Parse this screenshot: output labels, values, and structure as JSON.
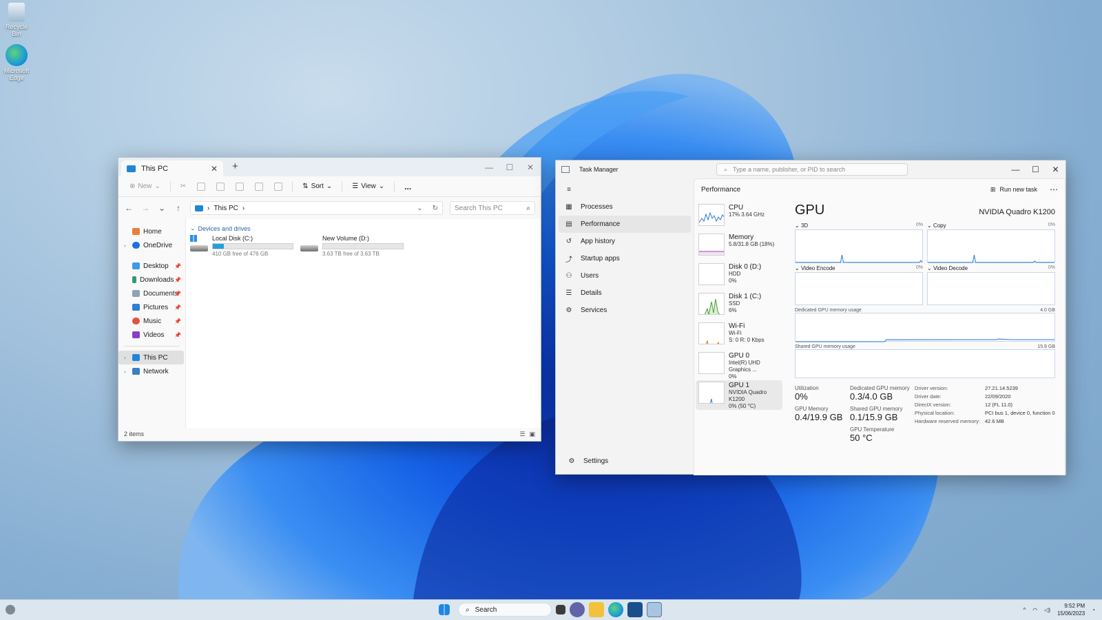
{
  "desktop": {
    "icons": [
      {
        "label": "Recycle Bin",
        "icon": "recycle-bin-icon"
      },
      {
        "label": "Microsoft Edge",
        "icon": "edge-icon"
      }
    ]
  },
  "explorer": {
    "tab_title": "This PC",
    "toolbar": {
      "new": "New",
      "sort": "Sort",
      "view": "View",
      "more": "..."
    },
    "breadcrumb": "This PC",
    "search_placeholder": "Search This PC",
    "nav": {
      "home": "Home",
      "onedrive": "OneDrive",
      "desktop": "Desktop",
      "downloads": "Downloads",
      "documents": "Documents",
      "pictures": "Pictures",
      "music": "Music",
      "videos": "Videos",
      "this_pc": "This PC",
      "network": "Network"
    },
    "group_label": "Devices and drives",
    "drives": [
      {
        "name": "Local Disk (C:)",
        "free": "410 GB free of 476 GB",
        "used_fraction": 0.14
      },
      {
        "name": "New Volume (D:)",
        "free": "3.63 TB free of 3.63 TB",
        "used_fraction": 0.0
      }
    ],
    "status": "2 items"
  },
  "taskmgr": {
    "title": "Task Manager",
    "search_placeholder": "Type a name, publisher, or PID to search",
    "nav": {
      "processes": "Processes",
      "performance": "Performance",
      "app_history": "App history",
      "startup_apps": "Startup apps",
      "users": "Users",
      "details": "Details",
      "services": "Services",
      "settings": "Settings"
    },
    "header_title": "Performance",
    "run_new_task": "Run new task",
    "resources": [
      {
        "name": "CPU",
        "line1": "17% 3.64 GHz",
        "line2": ""
      },
      {
        "name": "Memory",
        "line1": "5.8/31.8 GB (18%)",
        "line2": ""
      },
      {
        "name": "Disk 0 (D:)",
        "line1": "HDD",
        "line2": "0%"
      },
      {
        "name": "Disk 1 (C:)",
        "line1": "SSD",
        "line2": "6%"
      },
      {
        "name": "Wi-Fi",
        "line1": "Wi-Fi",
        "line2": "S: 0 R: 0 Kbps"
      },
      {
        "name": "GPU 0",
        "line1": "Intel(R) UHD Graphics ...",
        "line2": "0%"
      },
      {
        "name": "GPU 1",
        "line1": "NVIDIA Quadro K1200",
        "line2": "0% (50 °C)"
      }
    ],
    "gpu": {
      "title": "GPU",
      "model": "NVIDIA Quadro K1200",
      "engines": [
        {
          "name": "3D",
          "pct": "0%"
        },
        {
          "name": "Copy",
          "pct": "0%"
        },
        {
          "name": "Video Encode",
          "pct": "0%"
        },
        {
          "name": "Video Decode",
          "pct": "0%"
        }
      ],
      "dedicated_label": "Dedicated GPU memory usage",
      "dedicated_max": "4.0 GB",
      "shared_label": "Shared GPU memory usage",
      "shared_max": "15.9 GB",
      "stats": {
        "utilization_label": "Utilization",
        "utilization": "0%",
        "gpu_memory_label": "GPU Memory",
        "gpu_memory": "0.4/19.9 GB",
        "dedicated_label": "Dedicated GPU memory",
        "dedicated": "0.3/4.0 GB",
        "shared_label": "Shared GPU memory",
        "shared": "0.1/15.9 GB",
        "temp_label": "GPU Temperature",
        "temp": "50 °C"
      },
      "details": [
        {
          "k": "Driver version:",
          "v": "27.21.14.5239"
        },
        {
          "k": "Driver date:",
          "v": "22/09/2020"
        },
        {
          "k": "DirectX version:",
          "v": "12 (FL 11.0)"
        },
        {
          "k": "Physical location:",
          "v": "PCI bus 1, device 0, function 0"
        },
        {
          "k": "Hardware reserved memory:",
          "v": "42.6 MB"
        }
      ]
    }
  },
  "taskbar": {
    "search": "Search",
    "time": "9:52 PM",
    "date": "15/06/2023"
  }
}
